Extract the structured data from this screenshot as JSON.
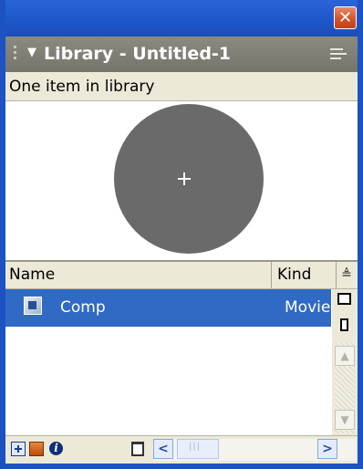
{
  "window": {
    "close_glyph": "✕"
  },
  "panel": {
    "title": "Library - Untitled-1",
    "collapse_glyph": "▼",
    "item_count_text": "One item in library"
  },
  "columns": {
    "name": "Name",
    "kind": "Kind",
    "sort_glyph": "≜"
  },
  "items": [
    {
      "name": "Comp",
      "kind": "Movie",
      "selected": true,
      "icon": "movie-clip-icon"
    }
  ],
  "scroll": {
    "up_glyph": "▲",
    "down_glyph": "▼",
    "left_glyph": "<",
    "right_glyph": ">"
  },
  "toolbar": {
    "info_glyph": "i"
  },
  "colors": {
    "title_bar": "#76746b",
    "selection": "#316ac5",
    "symbol_fill": "#6a6a6a",
    "frame": "#1c52c2"
  }
}
